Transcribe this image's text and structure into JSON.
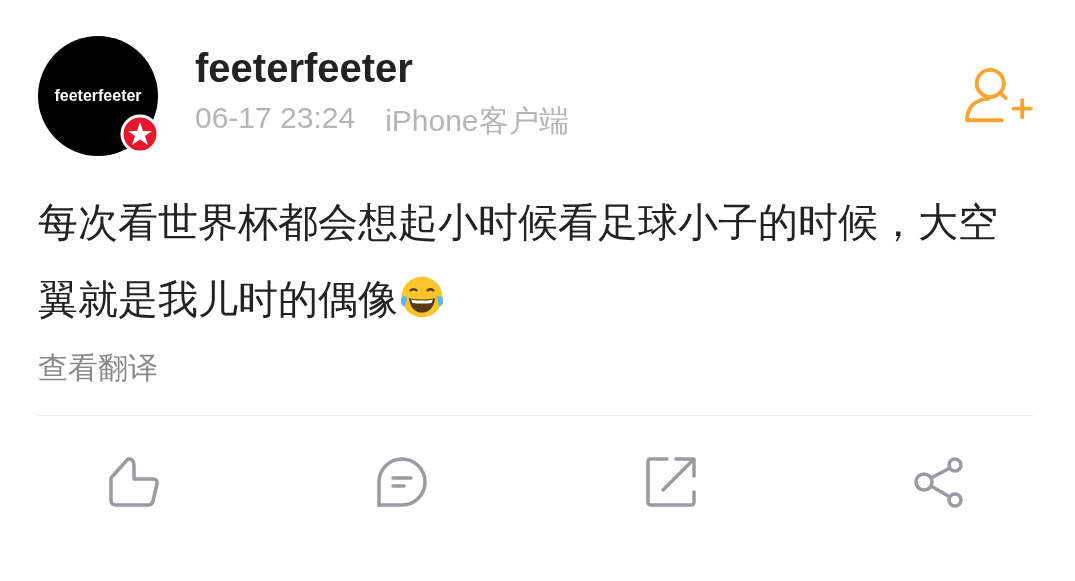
{
  "post": {
    "avatar_text": "feeterfeeter",
    "verified": true,
    "username": "feeterfeeter",
    "time": "06-17 23:24",
    "source": "iPhone客户端",
    "content": "每次看世界杯都会想起小时候看足球小子的时候，大空翼就是我儿时的偶像",
    "translate_link": "查看翻译"
  }
}
